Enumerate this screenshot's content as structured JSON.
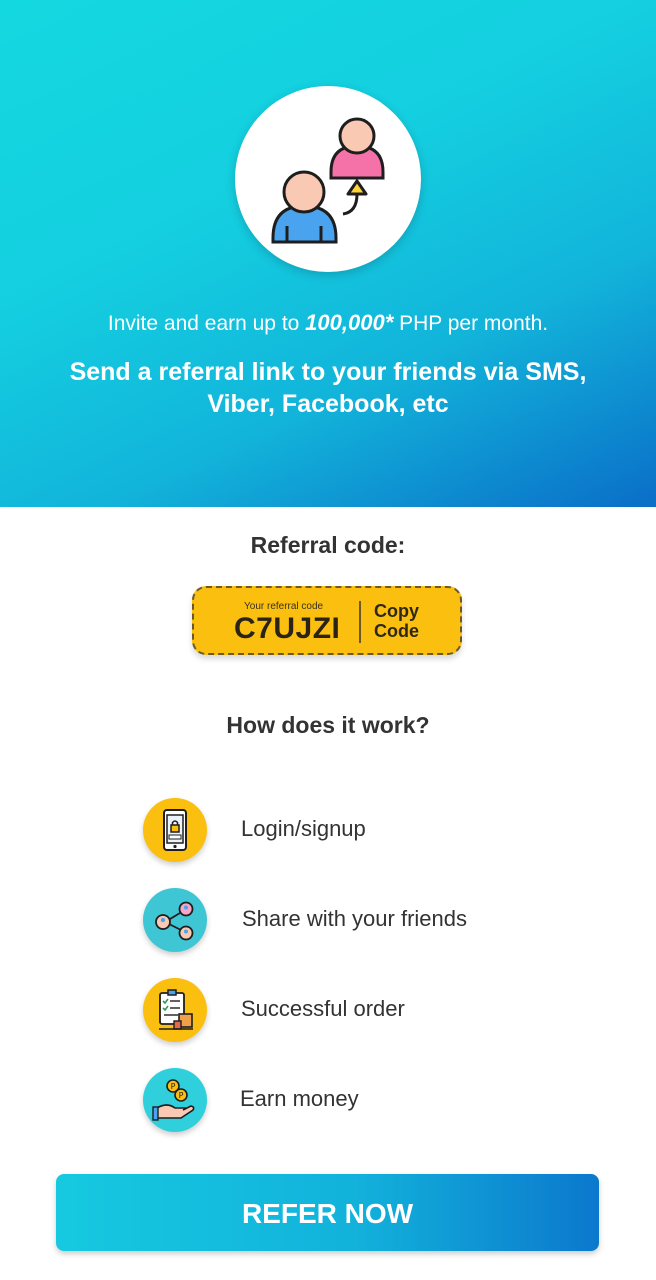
{
  "hero": {
    "line1_prefix": "Invite and earn up to ",
    "line1_amount": "100,000*",
    "line1_suffix": " PHP per month.",
    "line2": "Send a referral link to your friends via SMS, Viber, Facebook, etc",
    "illustration_icon": "referral-people-icon",
    "gradient": [
      "#14d8e0",
      "#0a6ec8"
    ]
  },
  "referral": {
    "title": "Referral code:",
    "small_label": "Your referral code",
    "code": "C7UJZI",
    "copy_line1": "Copy",
    "copy_line2": "Code",
    "accent": "#fbbf10"
  },
  "how": {
    "title": "How does it work?",
    "steps": [
      {
        "label": "Login/signup",
        "icon": "phone-lock-icon",
        "color": "#fbbf10"
      },
      {
        "label": "Share with your friends",
        "icon": "share-people-icon",
        "color": "#3fc6d4"
      },
      {
        "label": "Successful order",
        "icon": "order-checklist-icon",
        "color": "#fbbf10"
      },
      {
        "label": "Earn money",
        "icon": "hand-coins-icon",
        "color": "#2fd0dc"
      }
    ]
  },
  "cta": {
    "label": "REFER NOW"
  }
}
